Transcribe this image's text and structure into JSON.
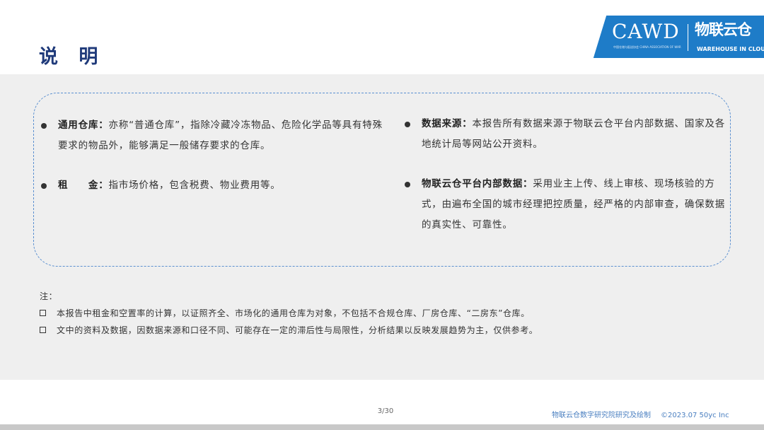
{
  "page": {
    "title": "说 明"
  },
  "logo": {
    "cawd": "CAWD",
    "cawd_sub": "中国仓储与配送协会 CHINA ASSOCIATION OF WAREHOUSING AND DISTRIBUTION",
    "brand_cn": "物联云仓",
    "brand_en": "WAREHOUSE IN CLOUD"
  },
  "definitions": {
    "left": [
      {
        "term": "通用仓库：",
        "text": "亦称“普通仓库”，指除冷藏冷冻物品、危险化学品等具有特殊要求的物品外，能够满足一般储存要求的仓库。"
      },
      {
        "term": "租　　金：",
        "text": "指市场价格，包含税费、物业费用等。"
      }
    ],
    "right": [
      {
        "term": "数据来源：",
        "text": "本报告所有数据来源于物联云仓平台内部数据、国家及各地统计局等网站公开资料。"
      },
      {
        "term": "物联云仓平台内部数据：",
        "text": "采用业主上传、线上审核、现场核验的方式，由遍布全国的城市经理把控质量，经严格的内部审查，确保数据的真实性、可靠性。"
      }
    ]
  },
  "notes": {
    "label": "注：",
    "items": [
      "本报告中租金和空置率的计算，以证照齐全、市场化的通用仓库为对象，不包括不合规仓库、厂房仓库、“二房东”仓库。",
      "文中的资料及数据，因数据来源和口径不同、可能存在一定的滞后性与局限性，分析结果以反映发展趋势为主，仅供参考。"
    ]
  },
  "footer": {
    "page_number": "3/30",
    "credit": "物联云仓数字研究院研究及绘制",
    "copyright": "©2023.07  50yc Inc"
  },
  "colors": {
    "title": "#1f3a7a",
    "logo_bg": "#1e7cc8",
    "box_border": "#5a8fd0",
    "content_bg": "#efefef"
  }
}
